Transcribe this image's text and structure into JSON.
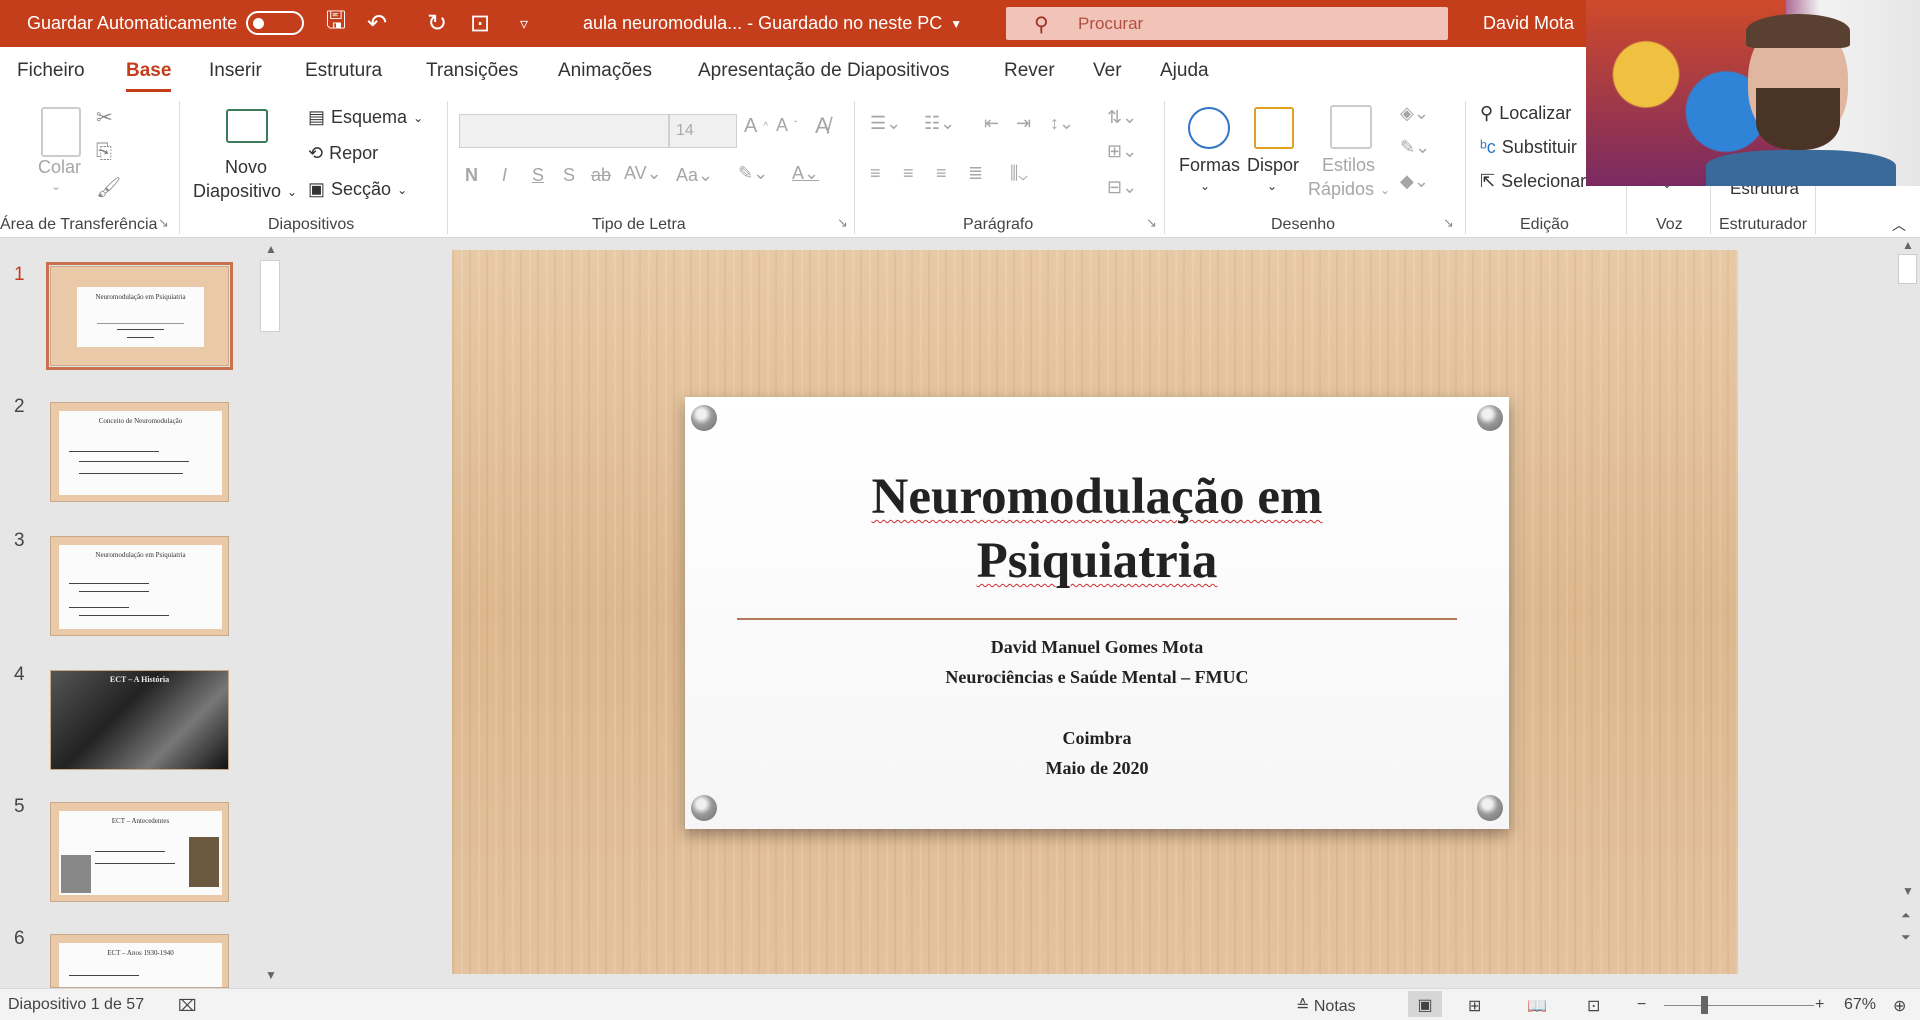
{
  "titlebar": {
    "autosave_label": "Guardar Automaticamente",
    "doc_title": "aula neuromodula...  -  Guardado no neste PC",
    "search_placeholder": "Procurar",
    "user_name": "David Mota",
    "accent_color": "#c43e1c"
  },
  "tabs": [
    {
      "label": "Ficheiro"
    },
    {
      "label": "Base"
    },
    {
      "label": "Inserir"
    },
    {
      "label": "Estrutura"
    },
    {
      "label": "Transições"
    },
    {
      "label": "Animações"
    },
    {
      "label": "Apresentação de Diapositivos"
    },
    {
      "label": "Rever"
    },
    {
      "label": "Ver"
    },
    {
      "label": "Ajuda"
    }
  ],
  "ribbon": {
    "clipboard": {
      "paste": "Colar",
      "group": "Área de Transferência"
    },
    "slides": {
      "new_slide_line1": "Novo",
      "new_slide_line2": "Diapositivo",
      "layout": "Esquema",
      "reset": "Repor",
      "section": "Secção",
      "group": "Diapositivos"
    },
    "font": {
      "font_size": "14",
      "bold": "N",
      "italic": "I",
      "underline": "S",
      "shadow": "S",
      "strike": "ab",
      "group": "Tipo de Letra"
    },
    "paragraph": {
      "group": "Parágrafo"
    },
    "drawing": {
      "shapes": "Formas",
      "arrange": "Dispor",
      "quick_styles_1": "Estilos",
      "quick_styles_2": "Rápidos",
      "group": "Desenho"
    },
    "editing": {
      "find": "Localizar",
      "replace": "Substituir",
      "select": "Selecionar",
      "group": "Edição"
    },
    "voice": {
      "group": "Voz"
    },
    "designer": {
      "button": "Estrutura",
      "group": "Estruturador"
    }
  },
  "thumbnails": [
    {
      "num": "1",
      "title": "Neuromodulação em Psiquiatria"
    },
    {
      "num": "2",
      "title": "Conceito de Neuromodulação"
    },
    {
      "num": "3",
      "title": "Neuromodulação em Psiquiatria"
    },
    {
      "num": "4",
      "title": "ECT – A História"
    },
    {
      "num": "5",
      "title": "ECT – Antecedentes"
    },
    {
      "num": "6",
      "title": "ECT – Anos 1930-1940"
    }
  ],
  "slide": {
    "title_line1": "Neuromodulação em",
    "title_line2": "Psiquiatria",
    "author": "David Manuel Gomes Mota",
    "affiliation": "Neurociências e Saúde Mental – FMUC",
    "city": "Coimbra",
    "date": "Maio de 2020"
  },
  "statusbar": {
    "slide_counter": "Diapositivo 1 de 57",
    "notes_label": "Notas",
    "zoom_level": "67%"
  }
}
